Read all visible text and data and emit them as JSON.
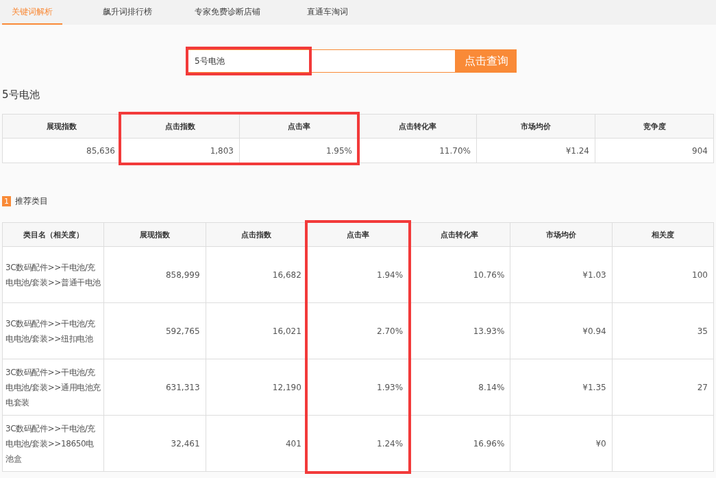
{
  "tabs": [
    {
      "label": "关键词解析",
      "selected": true
    },
    {
      "label": "飙升词排行榜",
      "selected": false
    },
    {
      "label": "专家免费诊断店铺",
      "selected": false
    },
    {
      "label": "直通车淘词",
      "selected": false
    }
  ],
  "search": {
    "value": "5号电池",
    "button": "点击查询",
    "annotated": true
  },
  "keyword_title": "5号电池",
  "summary_table": {
    "columns": [
      {
        "label": "展现指数",
        "annotated": false
      },
      {
        "label": "点击指数",
        "annotated": true
      },
      {
        "label": "点击率",
        "annotated": true
      },
      {
        "label": "点击转化率",
        "annotated": false
      },
      {
        "label": "市场均价",
        "annotated": false
      },
      {
        "label": "竞争度",
        "annotated": false
      }
    ],
    "row": [
      "85,636",
      "1,803",
      "1.95%",
      "11.70%",
      "¥1.24",
      "904"
    ]
  },
  "section": {
    "badge": "1",
    "title": "推荐类目"
  },
  "category_table": {
    "columns": [
      {
        "label": "类目名（相关度）",
        "annotated": false
      },
      {
        "label": "展现指数",
        "annotated": false
      },
      {
        "label": "点击指数",
        "annotated": false
      },
      {
        "label": "点击率",
        "annotated": true
      },
      {
        "label": "点击转化率",
        "annotated": false
      },
      {
        "label": "市场均价",
        "annotated": false
      },
      {
        "label": "相关度",
        "annotated": false
      }
    ],
    "rows": [
      [
        "3C数码配件>>干电池/充电电池/套装>>普通干电池",
        "858,999",
        "16,682",
        "1.94%",
        "10.76%",
        "¥1.03",
        "100"
      ],
      [
        "3C数码配件>>干电池/充电电池/套装>>纽扣电池",
        "592,765",
        "16,021",
        "2.70%",
        "13.93%",
        "¥0.94",
        "35"
      ],
      [
        "3C数码配件>>干电池/充电电池/套装>>通用电池充电套装",
        "631,313",
        "12,190",
        "1.93%",
        "8.14%",
        "¥1.35",
        "27"
      ],
      [
        "3C数码配件>>干电池/充电电池/套装>>18650电池盒",
        "32,461",
        "401",
        "1.24%",
        "16.96%",
        "¥0"
      ]
    ]
  }
}
